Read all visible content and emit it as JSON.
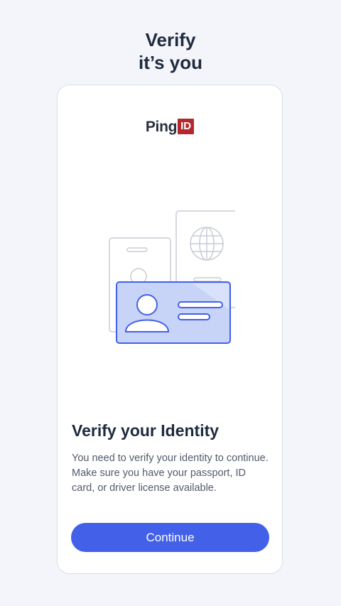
{
  "header": {
    "title_line1": "Verify",
    "title_line2": "it’s you"
  },
  "card": {
    "logo": {
      "text": "Ping",
      "badge": "ID",
      "badge_color": "#b3282d"
    },
    "illustration": "identity-documents-illustration",
    "heading": "Verify your Identity",
    "description": "You need to verify your identity to continue. Make sure you have your passport, ID card, or driver license available.",
    "continue_label": "Continue"
  },
  "colors": {
    "background": "#f3f5fa",
    "accent": "#4261e8",
    "heading": "#1f2a3d"
  }
}
